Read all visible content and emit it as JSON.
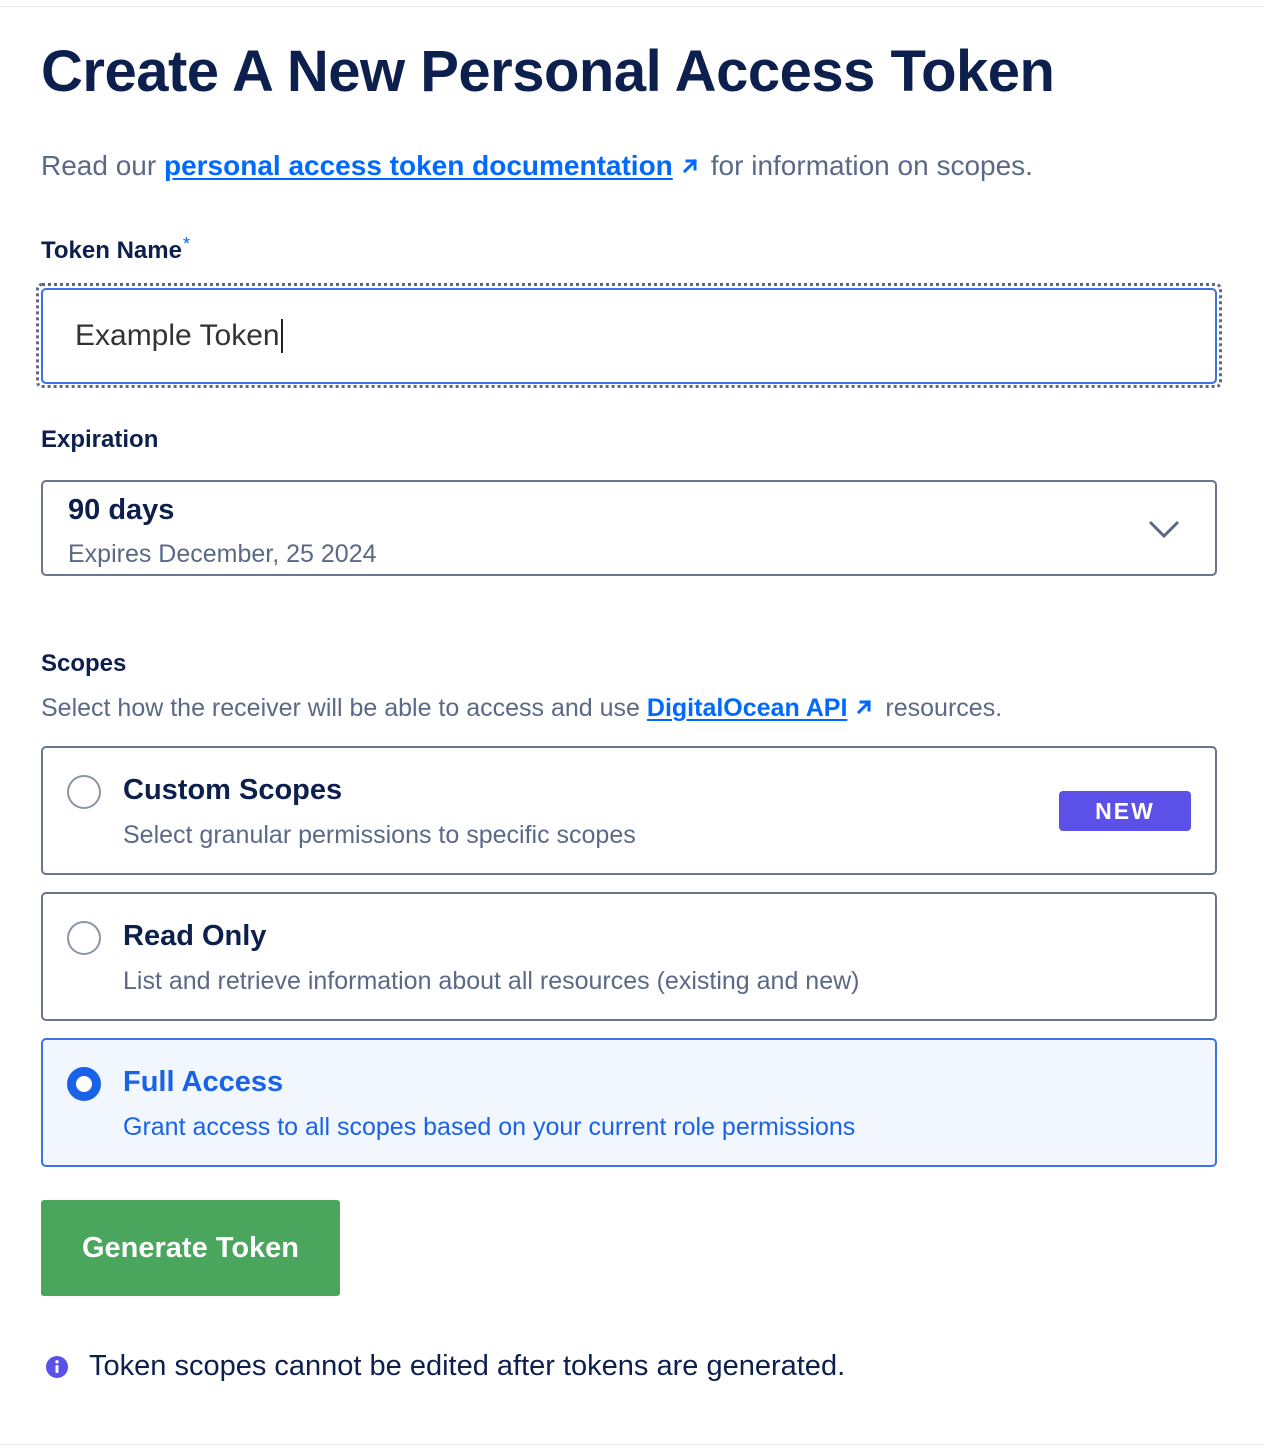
{
  "title": "Create A New Personal Access Token",
  "intro": {
    "prefix": "Read our",
    "link_text": "personal access token documentation",
    "suffix": "for information on scopes."
  },
  "token_name": {
    "label": "Token Name",
    "required_mark": "*",
    "value": "Example Token"
  },
  "expiration": {
    "label": "Expiration",
    "selected": "90 days",
    "subtext": "Expires December, 25 2024"
  },
  "scopes": {
    "label": "Scopes",
    "desc_prefix": "Select how the receiver will be able to access and use",
    "desc_link": "DigitalOcean API",
    "desc_suffix": "resources.",
    "options": [
      {
        "title": "Custom Scopes",
        "desc": "Select granular permissions to specific scopes",
        "badge": "NEW",
        "selected": false
      },
      {
        "title": "Read Only",
        "desc": "List and retrieve information about all resources (existing and new)",
        "selected": false
      },
      {
        "title": "Full Access",
        "desc": "Grant access to all scopes based on your current role permissions",
        "selected": true
      }
    ]
  },
  "generate_button": "Generate Token",
  "note": "Token scopes cannot be edited after tokens are generated.",
  "colors": {
    "link": "#0069ff",
    "selected": "#1a63e8",
    "badge": "#5b50e8",
    "button": "#4aa65c",
    "heading": "#0c1f4d"
  },
  "icons": [
    "external-link-icon",
    "chevron-down-icon",
    "radio-icon",
    "info-icon"
  ]
}
